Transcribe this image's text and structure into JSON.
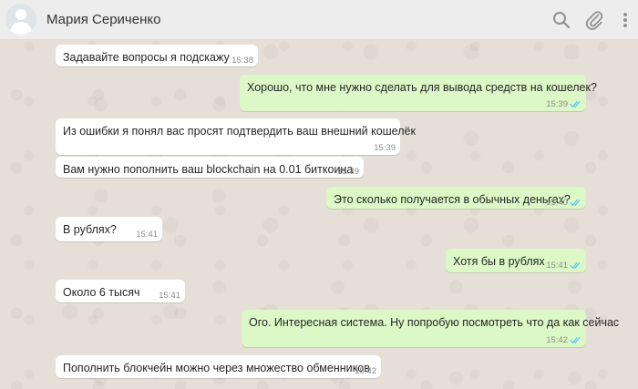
{
  "header": {
    "contact_name": "Мария Сериченко",
    "icons": [
      "search-icon",
      "attach-icon",
      "menu-icon"
    ]
  },
  "messages": [
    {
      "direction": "in",
      "text": "Задавайте вопросы я подскажу",
      "time": "15:38"
    },
    {
      "direction": "out",
      "text": "Хорошо, что мне нужно сделать для вывода средств на кошелек?",
      "time": "15:39",
      "status": "read"
    },
    {
      "direction": "in",
      "text": "Из ошибки я понял вас просят подтвердить ваш внешний кошелёк",
      "time": "15:39"
    },
    {
      "direction": "in",
      "text": "Вам нужно пополнить ваш blockchain на 0.01 биткоина",
      "time": "15:39"
    },
    {
      "direction": "out",
      "text": "Это сколько получается в обычных деньгах?",
      "time": "15:40",
      "status": "read"
    },
    {
      "direction": "in",
      "text": "В рублях?",
      "time": "15:41"
    },
    {
      "direction": "out",
      "text": "Хотя бы в рублях",
      "time": "15:41",
      "status": "read"
    },
    {
      "direction": "in",
      "text": "Около 6 тысяч",
      "time": "15:41"
    },
    {
      "direction": "out",
      "text": "Ого. Интересная система. Ну попробую посмотреть что да как сейчас",
      "time": "15:42",
      "status": "read"
    },
    {
      "direction": "in",
      "text": "Пополнить блокчейн можно через множество обменников",
      "time": "15:42"
    }
  ],
  "colors": {
    "incoming_bubble": "#ffffff",
    "outgoing_bubble": "#dcf8c6",
    "read_ticks": "#4fc3f7",
    "header_bg": "#ededed"
  }
}
